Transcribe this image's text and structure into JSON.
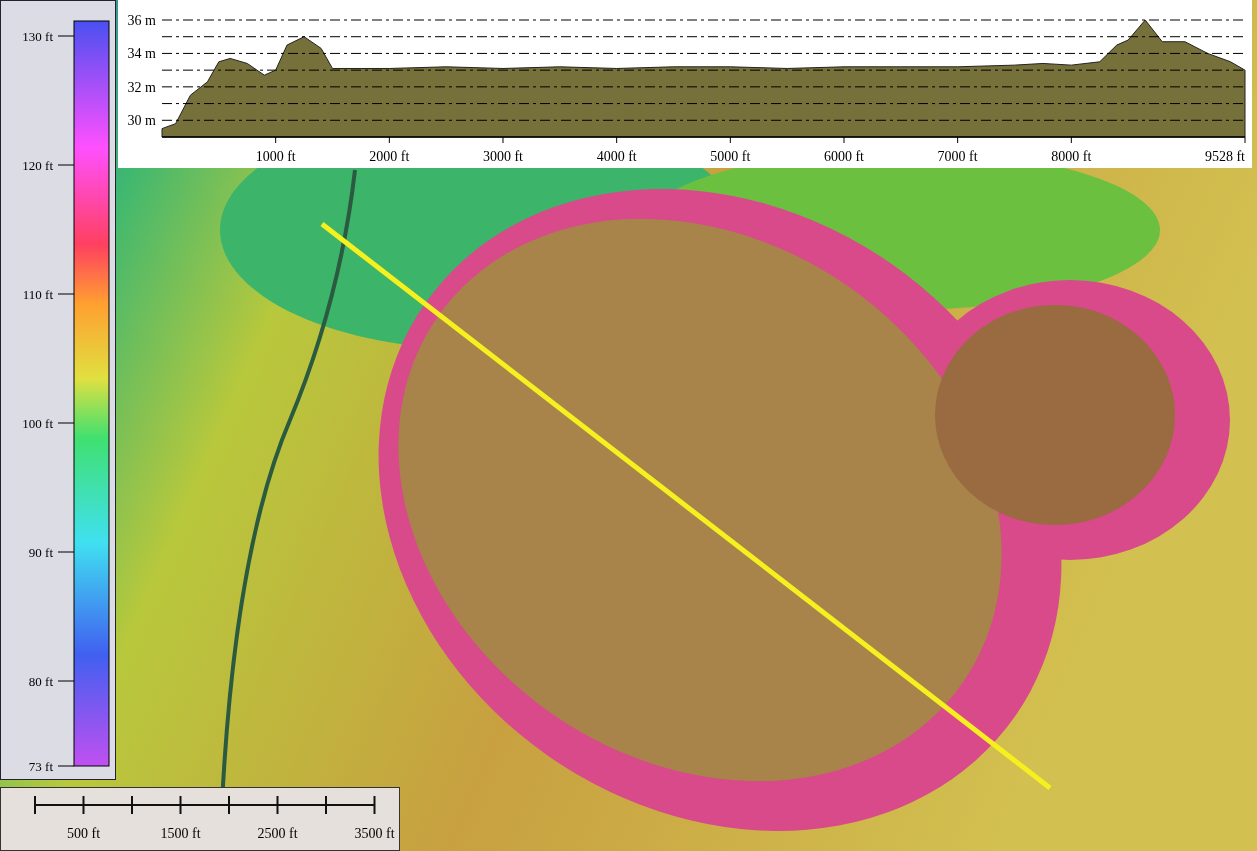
{
  "legend": {
    "labels": [
      "130 ft",
      "120 ft",
      "110 ft",
      "100 ft",
      "90 ft",
      "80 ft",
      "73 ft"
    ]
  },
  "profile": {
    "chart_data": {
      "type": "area",
      "x": [
        0,
        120,
        250,
        400,
        500,
        600,
        750,
        900,
        1000,
        1100,
        1250,
        1400,
        1500,
        1750,
        2000,
        2500,
        3000,
        3500,
        4000,
        4500,
        5000,
        5500,
        6000,
        6500,
        7000,
        7500,
        7750,
        8000,
        8250,
        8400,
        8500,
        8650,
        8800,
        9000,
        9200,
        9400,
        9528
      ],
      "series": [
        {
          "color": "#76703a",
          "values": [
            29.5,
            29.8,
            31.5,
            32.3,
            33.5,
            33.7,
            33.4,
            32.7,
            33.0,
            34.5,
            35.0,
            34.3,
            33.1,
            33.1,
            33.1,
            33.2,
            33.1,
            33.2,
            33.1,
            33.2,
            33.2,
            33.1,
            33.2,
            33.2,
            33.2,
            33.3,
            33.4,
            33.3,
            33.5,
            34.5,
            34.8,
            36.0,
            34.7,
            34.7,
            34.0,
            33.5,
            33.0
          ]
        }
      ],
      "xlim": [
        0,
        9528
      ],
      "ylim": [
        29,
        36
      ],
      "grid": true,
      "xticks": [
        {
          "value": 1000,
          "label": "1000 ft"
        },
        {
          "value": 2000,
          "label": "2000 ft"
        },
        {
          "value": 3000,
          "label": "3000 ft"
        },
        {
          "value": 4000,
          "label": "4000 ft"
        },
        {
          "value": 5000,
          "label": "5000 ft"
        },
        {
          "value": 6000,
          "label": "6000 ft"
        },
        {
          "value": 7000,
          "label": "7000 ft"
        },
        {
          "value": 8000,
          "label": "8000 ft"
        },
        {
          "value": 9528,
          "label": "9528 ft"
        }
      ],
      "yticks": [
        {
          "value": 30,
          "label": "30 m"
        },
        {
          "value": 32,
          "label": "32 m"
        },
        {
          "value": 34,
          "label": "34 m"
        },
        {
          "value": 36,
          "label": "36 m"
        }
      ]
    }
  },
  "scale_bar": {
    "labels": [
      "500 ft",
      "1500 ft",
      "2500 ft",
      "3500 ft"
    ]
  }
}
